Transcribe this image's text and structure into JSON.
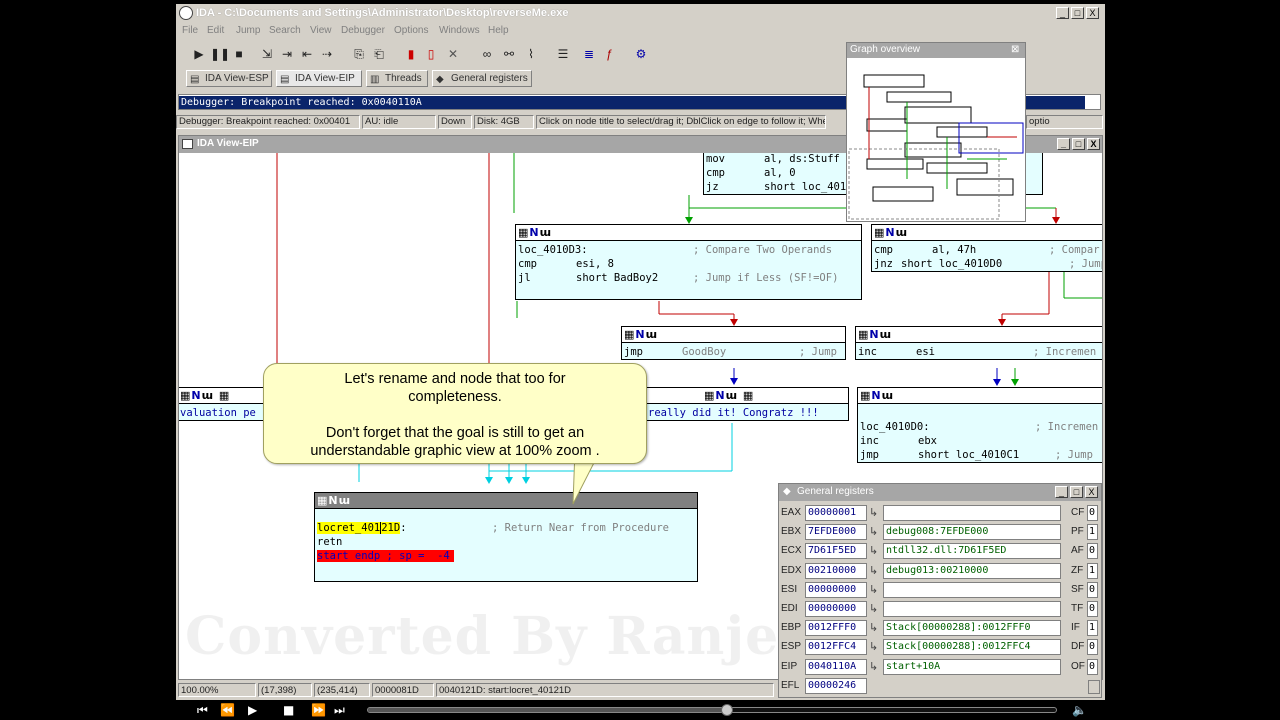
{
  "window": {
    "title": "IDA - C:\\Documents and Settings\\Administrator\\Desktop\\reverseMe.exe",
    "controls": [
      "_",
      "□",
      "X"
    ]
  },
  "menu": [
    "File",
    "Edit",
    "Jump",
    "Search",
    "View",
    "Debugger",
    "Options",
    "Windows",
    "Help"
  ],
  "toolbar_icons": [
    "play-icon",
    "pause-icon",
    "stop-icon",
    "step-into-icon",
    "step-over-icon",
    "run-until-return-icon",
    "run-to-cursor-icon",
    "attach-icon",
    "detach-icon",
    "terminate-icon",
    "breakpoint-toggle-icon",
    "breakpoint-delete-icon",
    "close-icon",
    "link-icon",
    "unlink-icon",
    "trace-icon",
    "list-icon",
    "function-list-icon",
    "function-icon",
    "register-icon"
  ],
  "tabs": [
    {
      "label": "IDA View-ESP",
      "icon": "view-icon"
    },
    {
      "label": "IDA View-EIP",
      "icon": "view-icon"
    },
    {
      "label": "Threads",
      "icon": "threads-icon"
    },
    {
      "label": "General registers",
      "icon": "registers-icon"
    }
  ],
  "output": {
    "message": "Debugger: Breakpoint reached: 0x0040110A"
  },
  "status": {
    "msg": "Debugger: Breakpoint reached: 0x00401",
    "au": "AU:  idle",
    "dir": "Down",
    "disk": "Disk: 4GB",
    "hint": "Click on node title to select/drag it; DblClick on edge to follow it; Wheel...",
    "tail": "optio"
  },
  "view": {
    "title": "IDA View-EIP"
  },
  "nodes": {
    "top": {
      "lines": [
        {
          "op": "mov",
          "args": "al, ds:Stuff",
          "cmt": ""
        },
        {
          "op": "cmp",
          "args": "al, 0",
          "cmt": ""
        },
        {
          "op": "jz",
          "args": "short loc_401",
          "cmt": ""
        }
      ]
    },
    "n4010d3": {
      "label": "loc_4010D3:",
      "label_cmt": "; Compare Two Operands",
      "lines": [
        {
          "op": "cmp",
          "args": "esi, 8",
          "cmt": ""
        },
        {
          "op": "jl",
          "args": "short BadBoy2",
          "cmt": "; Jump if Less (SF!=OF)"
        }
      ]
    },
    "ncmp47": {
      "lines": [
        {
          "op": "cmp",
          "args": "al, 47h",
          "cmt": "; Compar"
        },
        {
          "op": "jnz",
          "args": "short loc_4010D0",
          "cmt": "; Jump"
        }
      ]
    },
    "njmpgood": {
      "lines": [
        {
          "op": "jmp",
          "args": "GoodBoy",
          "cmt": "; Jump"
        }
      ]
    },
    "nincesi": {
      "lines": [
        {
          "op": "inc",
          "args": "esi",
          "cmt": "; Incremen"
        }
      ]
    },
    "nleft": {
      "text": "valuation pe"
    },
    "nmid": {
      "text": "really did it! Congratz !!!"
    },
    "n4010d0": {
      "label": "loc_4010D0:",
      "label_cmt": "; Incremen",
      "lines": [
        {
          "op": "inc",
          "args": "ebx",
          "cmt": ""
        },
        {
          "op": "jmp",
          "args": "short loc_4010C1",
          "cmt": "; Jump"
        }
      ]
    },
    "nret": {
      "label_a": "locret_401",
      "label_b": "2",
      "label_c": "1D",
      "label_suffix": ":",
      "label_cmt": "; Return Near from Procedure",
      "op": "retn",
      "endp": "start endp ; sp =  -4"
    }
  },
  "tooltip": {
    "line1": "Let's rename and node that too for",
    "line2": "completeness.",
    "line3": "Don't forget that the goal is still to get an",
    "line4": "understandable graphic view at 100% zoom ."
  },
  "overview": {
    "title": "Graph overview"
  },
  "registers": {
    "title": "General registers",
    "rows": [
      {
        "name": "EAX",
        "value": "00000001",
        "desc": ""
      },
      {
        "name": "EBX",
        "value": "7EFDE000",
        "desc": "debug008:7EFDE000"
      },
      {
        "name": "ECX",
        "value": "7D61F5ED",
        "desc": "ntdll32.dll:7D61F5ED"
      },
      {
        "name": "EDX",
        "value": "00210000",
        "desc": "debug013:00210000"
      },
      {
        "name": "ESI",
        "value": "00000000",
        "desc": ""
      },
      {
        "name": "EDI",
        "value": "00000000",
        "desc": ""
      },
      {
        "name": "EBP",
        "value": "0012FFF0",
        "desc": "Stack[00000288]:0012FFF0"
      },
      {
        "name": "ESP",
        "value": "0012FFC4",
        "desc": "Stack[00000288]:0012FFC4"
      },
      {
        "name": "EIP",
        "value": "0040110A",
        "desc": "start+10A"
      },
      {
        "name": "EFL",
        "value": "00000246",
        "desc": ""
      }
    ],
    "flags": [
      {
        "name": "CF",
        "value": "0"
      },
      {
        "name": "PF",
        "value": "1"
      },
      {
        "name": "AF",
        "value": "0"
      },
      {
        "name": "ZF",
        "value": "1"
      },
      {
        "name": "SF",
        "value": "0"
      },
      {
        "name": "TF",
        "value": "0"
      },
      {
        "name": "IF",
        "value": "1"
      },
      {
        "name": "DF",
        "value": "0"
      },
      {
        "name": "OF",
        "value": "0"
      }
    ]
  },
  "bottom_status": {
    "zoom": "100.00%",
    "mouse": "(17,398)",
    "node": "(235,414)",
    "offset": "0000081D",
    "location": "0040121D: start:locret_40121D"
  },
  "watermark": "Converted By Ranjee",
  "player": {
    "progress": 0.52
  }
}
